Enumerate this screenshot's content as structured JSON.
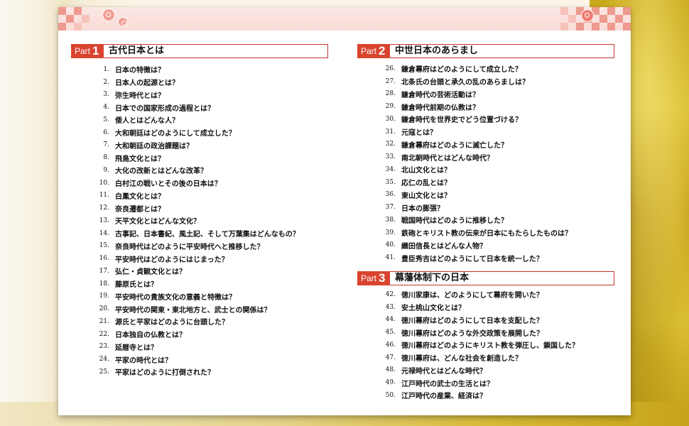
{
  "parts": [
    {
      "word": "Part",
      "number": "1",
      "title": "古代日本とは",
      "questions": [
        {
          "num": "1.",
          "text": "日本の特徴は？"
        },
        {
          "num": "2.",
          "text": "日本人の起源とは？"
        },
        {
          "num": "3.",
          "text": "弥生時代とは？"
        },
        {
          "num": "4.",
          "text": "日本での国家形成の過程とは？"
        },
        {
          "num": "5.",
          "text": "倭人とはどんな人？"
        },
        {
          "num": "6.",
          "text": "大和朝廷はどのようにして成立した？"
        },
        {
          "num": "7.",
          "text": "大和朝廷の政治課題は？"
        },
        {
          "num": "8.",
          "text": "飛鳥文化とは？"
        },
        {
          "num": "9.",
          "text": "大化の改新とはどんな改革？"
        },
        {
          "num": "10.",
          "text": "白村江の戦いとその後の日本は？"
        },
        {
          "num": "11.",
          "text": "白鳳文化とは？"
        },
        {
          "num": "12.",
          "text": "奈良遷都とは？"
        },
        {
          "num": "13.",
          "text": "天平文化とはどんな文化？"
        },
        {
          "num": "14.",
          "text": "古事記、日本書紀、風土記、そして万葉集はどんなもの？"
        },
        {
          "num": "15.",
          "text": "奈良時代はどのように平安時代へと推移した？"
        },
        {
          "num": "16.",
          "text": "平安時代はどのようにはじまった？"
        },
        {
          "num": "17.",
          "text": "弘仁・貞観文化とは？"
        },
        {
          "num": "18.",
          "text": "藤原氏とは？"
        },
        {
          "num": "19.",
          "text": "平安時代の貴族文化の意義と特徴は？"
        },
        {
          "num": "20.",
          "text": "平安時代の関東・東北地方と、武士との関係は？"
        },
        {
          "num": "21.",
          "text": "源氏と平家はどのように台頭した？"
        },
        {
          "num": "22.",
          "text": "日本独自の仏教とは？"
        },
        {
          "num": "23.",
          "text": "延暦寺とは？"
        },
        {
          "num": "24.",
          "text": "平家の時代とは？"
        },
        {
          "num": "25.",
          "text": "平家はどのように打倒された？"
        }
      ]
    },
    {
      "word": "Part",
      "number": "2",
      "title": "中世日本のあらまし",
      "questions": [
        {
          "num": "26.",
          "text": "鎌倉幕府はどのようにして成立した？"
        },
        {
          "num": "27.",
          "text": "北条氏の台頭と承久の乱のあらましは？"
        },
        {
          "num": "28.",
          "text": "鎌倉時代の芸術活動は？"
        },
        {
          "num": "29.",
          "text": "鎌倉時代前期の仏教は？"
        },
        {
          "num": "30.",
          "text": "鎌倉時代を世界史でどう位置づける？"
        },
        {
          "num": "31.",
          "text": "元寇とは？"
        },
        {
          "num": "32.",
          "text": "鎌倉幕府はどのように滅亡した？"
        },
        {
          "num": "33.",
          "text": "南北朝時代とはどんな時代？"
        },
        {
          "num": "34.",
          "text": "北山文化とは？"
        },
        {
          "num": "35.",
          "text": "応仁の乱とは？"
        },
        {
          "num": "36.",
          "text": "東山文化とは？"
        },
        {
          "num": "37.",
          "text": "日本の膨張？"
        },
        {
          "num": "38.",
          "text": "戦国時代はどのように推移した？"
        },
        {
          "num": "39.",
          "text": "鉄砲とキリスト教の伝来が日本にもたらしたものは？"
        },
        {
          "num": "40.",
          "text": "織田信長とはどんな人物？"
        },
        {
          "num": "41.",
          "text": "豊臣秀吉はどのようにして日本を統一した？"
        }
      ]
    },
    {
      "word": "Part",
      "number": "3",
      "title": "幕藩体制下の日本",
      "questions": [
        {
          "num": "42.",
          "text": "徳川家康は、どのようにして幕府を開いた？"
        },
        {
          "num": "43.",
          "text": "安土桃山文化とは？"
        },
        {
          "num": "44.",
          "text": "徳川幕府はどのようにして日本を支配した？"
        },
        {
          "num": "45.",
          "text": "徳川幕府はどのような外交政策を展開した？"
        },
        {
          "num": "46.",
          "text": "徳川幕府はどのようにキリスト教を弾圧し、鎖国した？"
        },
        {
          "num": "47.",
          "text": "徳川幕府は、どんな社会を創造した？"
        },
        {
          "num": "48.",
          "text": "元禄時代とはどんな時代？"
        },
        {
          "num": "49.",
          "text": "江戸時代の武士の生活とは？"
        },
        {
          "num": "50.",
          "text": "江戸時代の産業、経済は？"
        }
      ]
    }
  ]
}
